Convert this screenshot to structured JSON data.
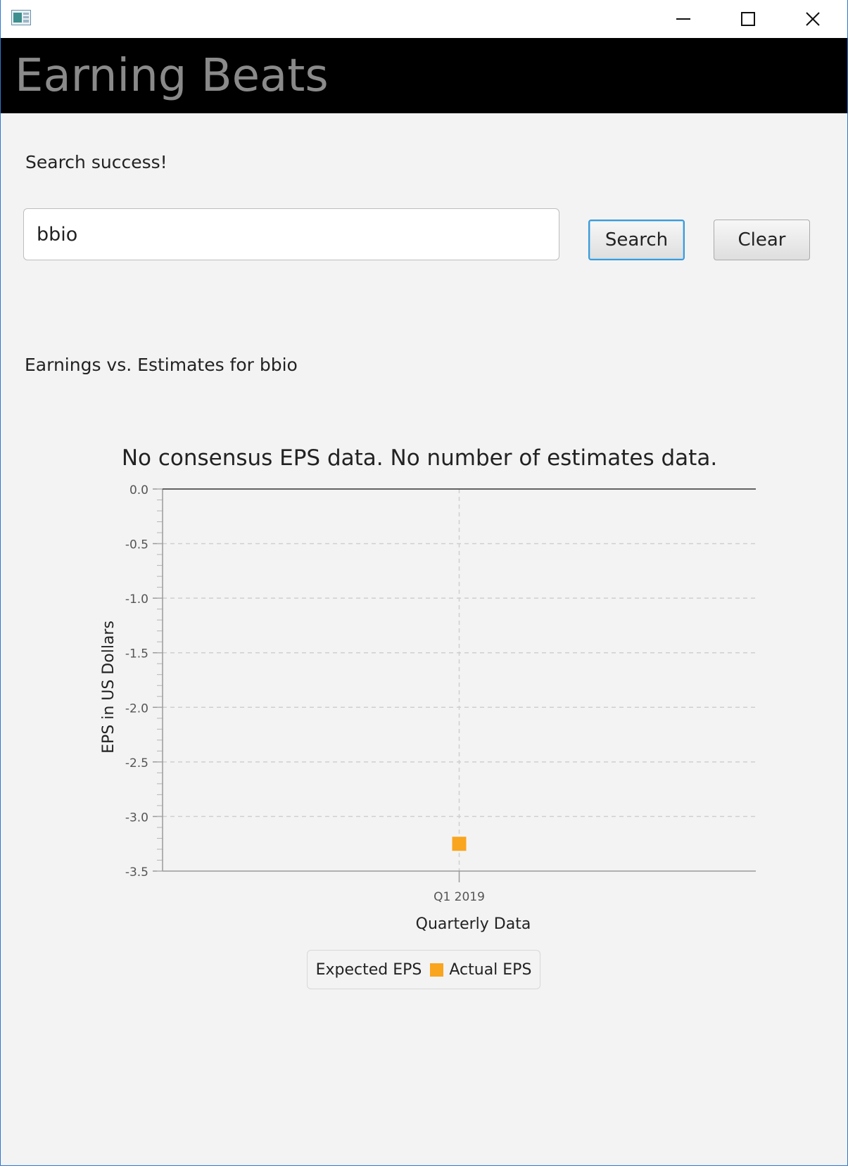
{
  "window": {
    "title": "",
    "controls": {
      "minimize": "minimize-icon",
      "maximize": "maximize-icon",
      "close": "close-icon"
    }
  },
  "app": {
    "title": "Earning Beats"
  },
  "status_text": "Search success!",
  "search": {
    "value": "bbio",
    "placeholder": ""
  },
  "buttons": {
    "search": "Search",
    "clear": "Clear"
  },
  "section_label": "Earnings vs. Estimates for bbio",
  "colors": {
    "accent": "#3a9ad9",
    "actual_eps": "#f9a51e",
    "header_bg": "#000000"
  },
  "chart_data": {
    "type": "scatter",
    "title": "No consensus EPS data. No number of estimates data.",
    "xlabel": "Quarterly Data",
    "ylabel": "EPS in US Dollars",
    "categories": [
      "Q1 2019"
    ],
    "ylim": [
      -3.5,
      0.0
    ],
    "y_ticks": [
      "0.0",
      "-0.5",
      "-1.0",
      "-1.5",
      "-2.0",
      "-2.5",
      "-3.0",
      "-3.5"
    ],
    "grid": true,
    "legend_position": "bottom",
    "series": [
      {
        "name": "Expected EPS",
        "values": []
      },
      {
        "name": "Actual EPS",
        "values": [
          -3.25
        ],
        "color": "#f9a51e"
      }
    ]
  }
}
